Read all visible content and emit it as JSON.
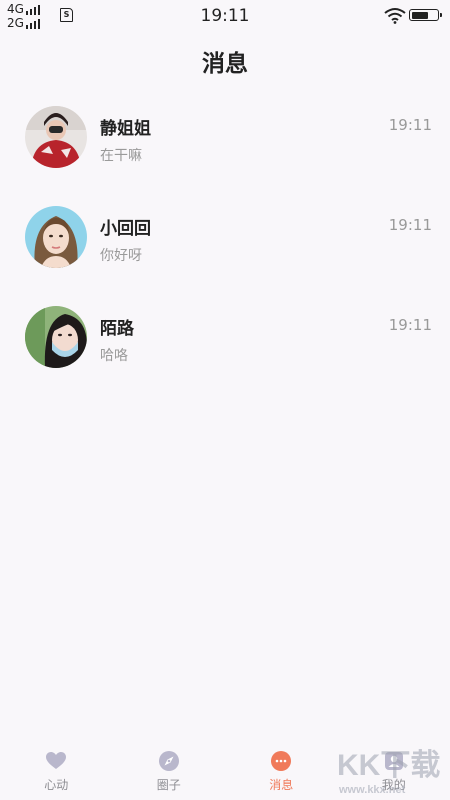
{
  "status_bar": {
    "network_1": "4G",
    "network_2": "2G",
    "sim_label": "S",
    "time": "19:11",
    "battery_level": 0.6
  },
  "header": {
    "title": "消息"
  },
  "conversations": [
    {
      "name": "静姐姐",
      "preview": "在干嘛",
      "time": "19:11"
    },
    {
      "name": "小回回",
      "preview": "你好呀",
      "time": "19:11"
    },
    {
      "name": "陌路",
      "preview": "哈咯",
      "time": "19:11"
    }
  ],
  "tabbar": {
    "tabs": [
      {
        "label": "心动",
        "icon": "heart-icon"
      },
      {
        "label": "圈子",
        "icon": "compass-icon"
      },
      {
        "label": "消息",
        "icon": "chat-bubble-icon",
        "active": true
      },
      {
        "label": "我的",
        "icon": "profile-icon"
      }
    ],
    "inactive_color": "#b9b7cc",
    "active_color": "#f07a5a"
  },
  "watermark": {
    "line1": "KK下载",
    "line2": "www.kkx.net"
  }
}
